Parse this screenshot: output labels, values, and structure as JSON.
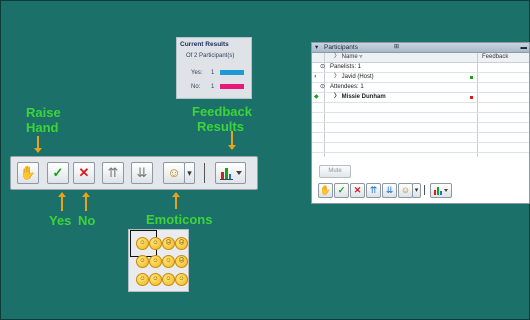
{
  "colors": {
    "background": "#1b7069",
    "callout_text": "#3dd43a",
    "arrow": "#e8a21b",
    "yes_bar": "#1d9ad6",
    "no_bar": "#e8187a"
  },
  "callouts": {
    "raise_hand": "Raise\nHand",
    "feedback_results": "Feedback\nResults",
    "yes": "Yes",
    "no": "No",
    "emoticons": "Emoticons"
  },
  "toolbar": {
    "buttons": [
      {
        "icon": "raise-hand-icon",
        "glyph": "✋"
      },
      {
        "icon": "yes-check-icon",
        "glyph": "✓"
      },
      {
        "icon": "no-x-icon",
        "glyph": "✕"
      },
      {
        "icon": "speed-up-icon",
        "glyph": "⇈"
      },
      {
        "icon": "slow-down-icon",
        "glyph": "⇊"
      },
      {
        "icon": "emoticon-icon",
        "glyph": "☺"
      }
    ],
    "dropdown_glyph": "▾",
    "feedback_results_icon": "bar-chart-icon"
  },
  "current_results": {
    "title": "Current Results",
    "subtitle": "Of 2 Participant(s)",
    "rows": [
      {
        "label": "Yes:",
        "count": "1",
        "fraction": 0.5
      },
      {
        "label": "No:",
        "count": "1",
        "fraction": 0.5
      }
    ]
  },
  "emoticons": {
    "rows": [
      [
        "☺",
        "☺",
        "☹",
        "☹"
      ],
      [
        "☺",
        "☺",
        "☺",
        "☹"
      ],
      [
        "☺",
        "☺",
        "☺",
        "☺"
      ]
    ]
  },
  "participants_panel": {
    "title": "Participants",
    "title_icon": "grid-icon",
    "columns": {
      "name": "Name",
      "feedback": "Feedback"
    },
    "rows": [
      {
        "type": "group",
        "label": "Panelists: 1"
      },
      {
        "type": "person",
        "label": "Javid (Host)",
        "status_color": "#1aa01a"
      },
      {
        "type": "group",
        "label": "Attendees: 1"
      },
      {
        "type": "person",
        "label": "Missie Dunham",
        "status_color": "#d81c1c",
        "bold": true
      }
    ],
    "mute_label": "Mute"
  }
}
